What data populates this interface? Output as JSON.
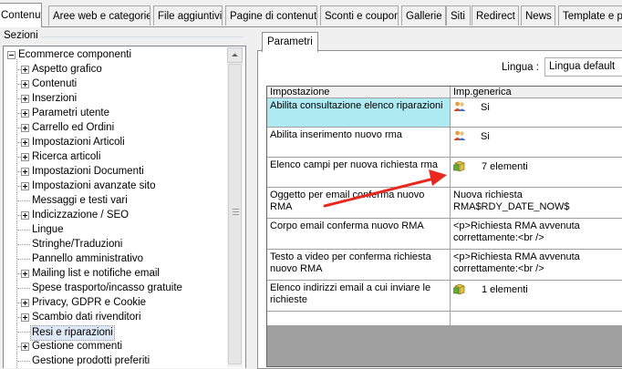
{
  "tabs": [
    {
      "label": "Contenuti",
      "active": true
    },
    {
      "label": "Aree web e categorie"
    },
    {
      "label": "File aggiuntivi"
    },
    {
      "label": "Pagine di contenuti"
    },
    {
      "label": "Sconti e coupon"
    },
    {
      "label": "Gallerie"
    },
    {
      "label": "Siti"
    },
    {
      "label": "Redirect"
    },
    {
      "label": "News"
    },
    {
      "label": "Template e pl"
    }
  ],
  "sidebar": {
    "title": "Sezioni",
    "root": "Ecommerce componenti",
    "items": [
      {
        "label": "Aspetto grafico",
        "expandable": true
      },
      {
        "label": "Contenuti",
        "expandable": true
      },
      {
        "label": "Inserzioni",
        "expandable": true
      },
      {
        "label": "Parametri utente",
        "expandable": true
      },
      {
        "label": "Carrello ed Ordini",
        "expandable": true
      },
      {
        "label": "Impostazioni Articoli",
        "expandable": true
      },
      {
        "label": "Ricerca articoli",
        "expandable": true
      },
      {
        "label": "Impostazioni Documenti",
        "expandable": true
      },
      {
        "label": "Impostazioni avanzate sito",
        "expandable": true
      },
      {
        "label": "Messaggi e testi vari",
        "expandable": false
      },
      {
        "label": "Indicizzazione / SEO",
        "expandable": true
      },
      {
        "label": "Lingue",
        "expandable": false
      },
      {
        "label": "Stringhe/Traduzioni",
        "expandable": false
      },
      {
        "label": "Pannello amministrativo",
        "expandable": false
      },
      {
        "label": "Mailing list e notifiche email",
        "expandable": true
      },
      {
        "label": "Spese trasporto/incasso gratuite",
        "expandable": false
      },
      {
        "label": "Privacy, GDPR e Cookie",
        "expandable": true
      },
      {
        "label": "Scambio dati rivenditori",
        "expandable": true
      },
      {
        "label": "Resi e riparazioni",
        "expandable": false,
        "selected": true
      },
      {
        "label": "Gestione commenti",
        "expandable": true
      },
      {
        "label": "Gestione prodotti preferiti",
        "expandable": false
      }
    ]
  },
  "panel": {
    "tab": "Parametri",
    "language_label": "Lingua :",
    "language_value": "Lingua default",
    "columns": [
      "Impostazione",
      "Imp.generica"
    ],
    "rows": [
      {
        "setting": "Abilita consultazione elenco riparazioni",
        "value": "Si",
        "icon": "users-icon",
        "selected": true
      },
      {
        "setting": "Abilita inserimento nuovo rma",
        "value": "Si",
        "icon": "users-icon"
      },
      {
        "setting": "Elenco campi per nuova richiesta rma",
        "value": "7 elementi",
        "icon": "package-icon"
      },
      {
        "setting": "Oggetto per email conferma nuovo RMA",
        "value": "Nuova richiesta RMA$RDY_DATE_NOW$",
        "icon": ""
      },
      {
        "setting": "Corpo email conferma nuovo RMA",
        "value": "<p>Richiesta RMA avvenuta correttamente:<br />",
        "icon": ""
      },
      {
        "setting": "Testo a video per conferma richiesta nuovo RMA",
        "value": "<p>Richiesta RMA avvenuta correttamente:<br />",
        "icon": ""
      },
      {
        "setting": "Elenco indirizzi email a cui inviare le richieste",
        "value": "1 elementi",
        "icon": "package-icon"
      },
      {
        "setting": "",
        "value": "",
        "icon": ""
      }
    ]
  },
  "colors": {
    "selected_row": "#aeeaf2",
    "arrow": "#e8291f",
    "tree_selection": "#dfe8f5"
  }
}
